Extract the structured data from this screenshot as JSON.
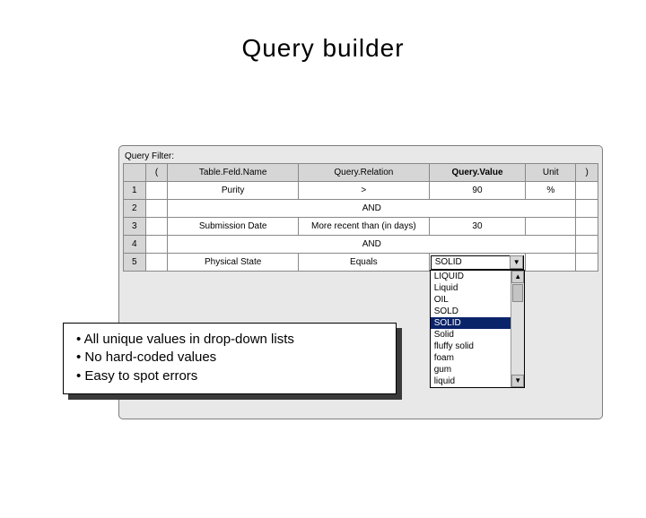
{
  "title": "Query builder",
  "panel": {
    "filter_label": "Query Filter:",
    "headers": {
      "lparen": "(",
      "field": "Table.Feld.Name",
      "relation": "Query.Relation",
      "value": "Query.Value",
      "unit": "Unit",
      "rparen": ")"
    },
    "rows": [
      {
        "n": "1",
        "field": "Purity",
        "relation": ">",
        "value": "90",
        "unit": "%"
      },
      {
        "n": "2",
        "and": "AND"
      },
      {
        "n": "3",
        "field": "Submission Date",
        "relation": "More recent than (in days)",
        "value": "30",
        "unit": ""
      },
      {
        "n": "4",
        "and": "AND"
      },
      {
        "n": "5",
        "field": "Physical State",
        "relation": "Equals",
        "value_dropdown": true
      }
    ],
    "dropdown": {
      "selected": "SOLID",
      "options": [
        "LIQUID",
        "Liquid",
        "OIL",
        "SOLD",
        "SOLID",
        "Solid",
        "fluffy solid",
        "foam",
        "gum",
        "liquid"
      ],
      "highlight_index": 4
    }
  },
  "callout": {
    "b1": "• All unique values in drop-down lists",
    "b2": "• No hard-coded values",
    "b3": "• Easy to spot errors"
  }
}
